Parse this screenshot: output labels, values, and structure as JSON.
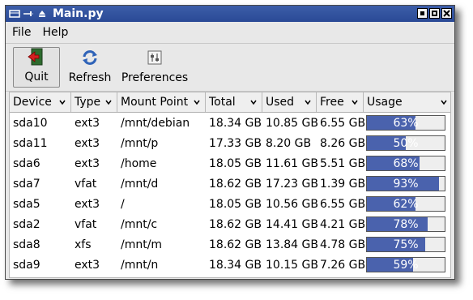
{
  "window": {
    "title": "Main.py"
  },
  "menubar": {
    "items": [
      {
        "label": "File"
      },
      {
        "label": "Help"
      }
    ]
  },
  "toolbar": {
    "quit_label": "Quit",
    "refresh_label": "Refresh",
    "preferences_label": "Preferences"
  },
  "table": {
    "columns": [
      {
        "label": "Device"
      },
      {
        "label": "Type"
      },
      {
        "label": "Mount Point"
      },
      {
        "label": "Total"
      },
      {
        "label": "Used"
      },
      {
        "label": "Free"
      },
      {
        "label": "Usage"
      }
    ],
    "rows": [
      {
        "device": "sda10",
        "type": "ext3",
        "mount": "/mnt/debian",
        "total": "18.34 GB",
        "used": "10.85 GB",
        "free": "6.55 GB",
        "usage": "63%",
        "usage_value": 0.63
      },
      {
        "device": "sda11",
        "type": "ext3",
        "mount": "/mnt/p",
        "total": "17.33 GB",
        "used": "8.20 GB",
        "free": "8.26 GB",
        "usage": "50%",
        "usage_value": 0.5
      },
      {
        "device": "sda6",
        "type": "ext3",
        "mount": "/home",
        "total": "18.05 GB",
        "used": "11.61 GB",
        "free": "5.51 GB",
        "usage": "68%",
        "usage_value": 0.68
      },
      {
        "device": "sda7",
        "type": "vfat",
        "mount": "/mnt/d",
        "total": "18.62 GB",
        "used": "17.23 GB",
        "free": "1.39 GB",
        "usage": "93%",
        "usage_value": 0.93
      },
      {
        "device": "sda5",
        "type": "ext3",
        "mount": "/",
        "total": "18.05 GB",
        "used": "10.56 GB",
        "free": "6.55 GB",
        "usage": "62%",
        "usage_value": 0.62
      },
      {
        "device": "sda2",
        "type": "vfat",
        "mount": "/mnt/c",
        "total": "18.62 GB",
        "used": "14.41 GB",
        "free": "4.21 GB",
        "usage": "78%",
        "usage_value": 0.78
      },
      {
        "device": "sda8",
        "type": "xfs",
        "mount": "/mnt/m",
        "total": "18.62 GB",
        "used": "13.84 GB",
        "free": "4.78 GB",
        "usage": "75%",
        "usage_value": 0.75
      },
      {
        "device": "sda9",
        "type": "ext3",
        "mount": "/mnt/n",
        "total": "18.34 GB",
        "used": "10.15 GB",
        "free": "7.26 GB",
        "usage": "59%",
        "usage_value": 0.59
      }
    ]
  },
  "colors": {
    "titlebar": "#2f4f9c",
    "usage_fill": "#4a62ad"
  },
  "icons": {
    "window_menu": "window-menu-icon",
    "pin": "pin-icon",
    "shade": "shade-icon",
    "minimize": "minimize-icon",
    "maximize": "maximize-icon",
    "close": "close-icon",
    "quit": "exit-door-icon",
    "refresh": "refresh-icon",
    "preferences": "preferences-icon",
    "sort": "chevron-down-icon"
  }
}
